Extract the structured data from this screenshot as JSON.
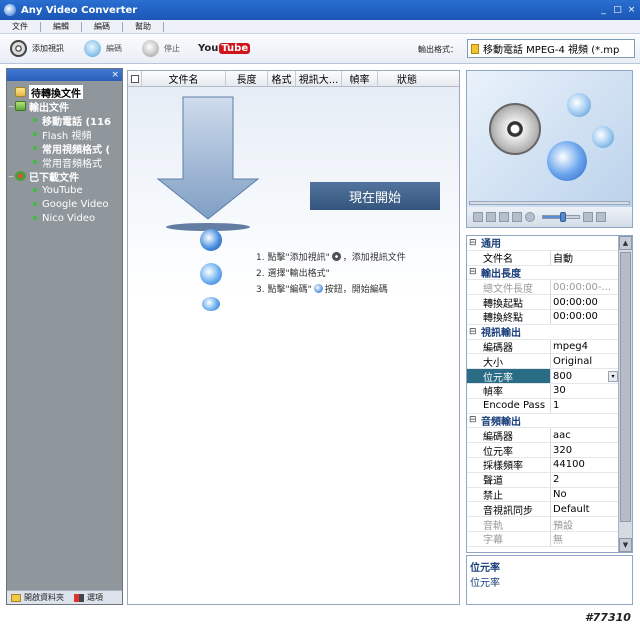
{
  "window": {
    "title": "Any Video Converter",
    "min": "_",
    "max": "□",
    "close": "×"
  },
  "menu": [
    "文件",
    "編輯",
    "編碼",
    "幫助"
  ],
  "toolbar": {
    "add_label": "添加視訊",
    "encode_label": "編碼",
    "stop_label": "停止",
    "youtube_you": "You",
    "youtube_tube": "Tube",
    "format_label": "輸出格式：",
    "format_value": "移動電話 MPEG-4 視頻 (*.mp"
  },
  "tree": {
    "items": [
      {
        "label": "待轉換文件",
        "level": 0,
        "bold": true,
        "selected": true,
        "icon": "doc"
      },
      {
        "label": "輸出文件",
        "level": 0,
        "bold": true,
        "expander": "−",
        "icon": "out"
      },
      {
        "label": "移動電話 (116",
        "level": 1,
        "bold": true
      },
      {
        "label": "Flash 視頻",
        "level": 1
      },
      {
        "label": "常用視頻格式 (",
        "level": 1,
        "bold": true
      },
      {
        "label": "常用音頻格式",
        "level": 1
      },
      {
        "label": "已下載文件",
        "level": 0,
        "bold": true,
        "expander": "−",
        "icon": "dl"
      },
      {
        "label": "YouTube",
        "level": 1
      },
      {
        "label": "Google Video",
        "level": 1
      },
      {
        "label": "Nico Video",
        "level": 1
      }
    ],
    "close": "×",
    "footer_open": "開啟資料夾",
    "footer_options": "選項"
  },
  "list": {
    "columns": [
      "文件名",
      "長度",
      "格式",
      "視訊大...",
      "幀率",
      "狀態"
    ],
    "start_now": "現在開始",
    "steps": [
      {
        "a": "1. 點擊\"添加視訊\"",
        "b": "，添加視訊文件"
      },
      {
        "a": "2. 選擇\"輸出格式\"",
        "b": ""
      },
      {
        "a": "3. 點擊\"編碼\"",
        "b": "按鈕，開始編碼"
      }
    ]
  },
  "preview": {
    "progress": 0,
    "volume": 0.55
  },
  "props": {
    "rows": [
      {
        "cat": true,
        "key": "通用",
        "toggle": "⊟"
      },
      {
        "key": "文件名",
        "val": "自動"
      },
      {
        "cat": true,
        "key": "輸出長度",
        "toggle": "⊟"
      },
      {
        "key": "總文件長度",
        "val": "00:00:00-...",
        "dim": true
      },
      {
        "key": "轉換起點",
        "val": "00:00:00"
      },
      {
        "key": "轉換終點",
        "val": "00:00:00"
      },
      {
        "cat": true,
        "key": "視訊輸出",
        "toggle": "⊟"
      },
      {
        "key": "編碼器",
        "val": "mpeg4"
      },
      {
        "key": "大小",
        "val": "Original"
      },
      {
        "key": "位元率",
        "val": "800",
        "selected": true,
        "dropdown": "▾"
      },
      {
        "key": "幀率",
        "val": "30"
      },
      {
        "key": "Encode Pass",
        "val": "1"
      },
      {
        "cat": true,
        "key": "音頻輸出",
        "toggle": "⊟"
      },
      {
        "key": "編碼器",
        "val": "aac"
      },
      {
        "key": "位元率",
        "val": "320"
      },
      {
        "key": "採樣頻率",
        "val": "44100"
      },
      {
        "key": "聲道",
        "val": "2"
      },
      {
        "key": "禁止",
        "val": "No"
      },
      {
        "key": "音視訊同步",
        "val": "Default"
      },
      {
        "key": "音軌",
        "val": "預設",
        "dim": true
      },
      {
        "key": "字幕",
        "val": "無",
        "dim": true
      }
    ],
    "scroll_up": "▲",
    "scroll_down": "▼"
  },
  "description": {
    "title": "位元率",
    "text": "位元率"
  },
  "watermark": "#77310"
}
